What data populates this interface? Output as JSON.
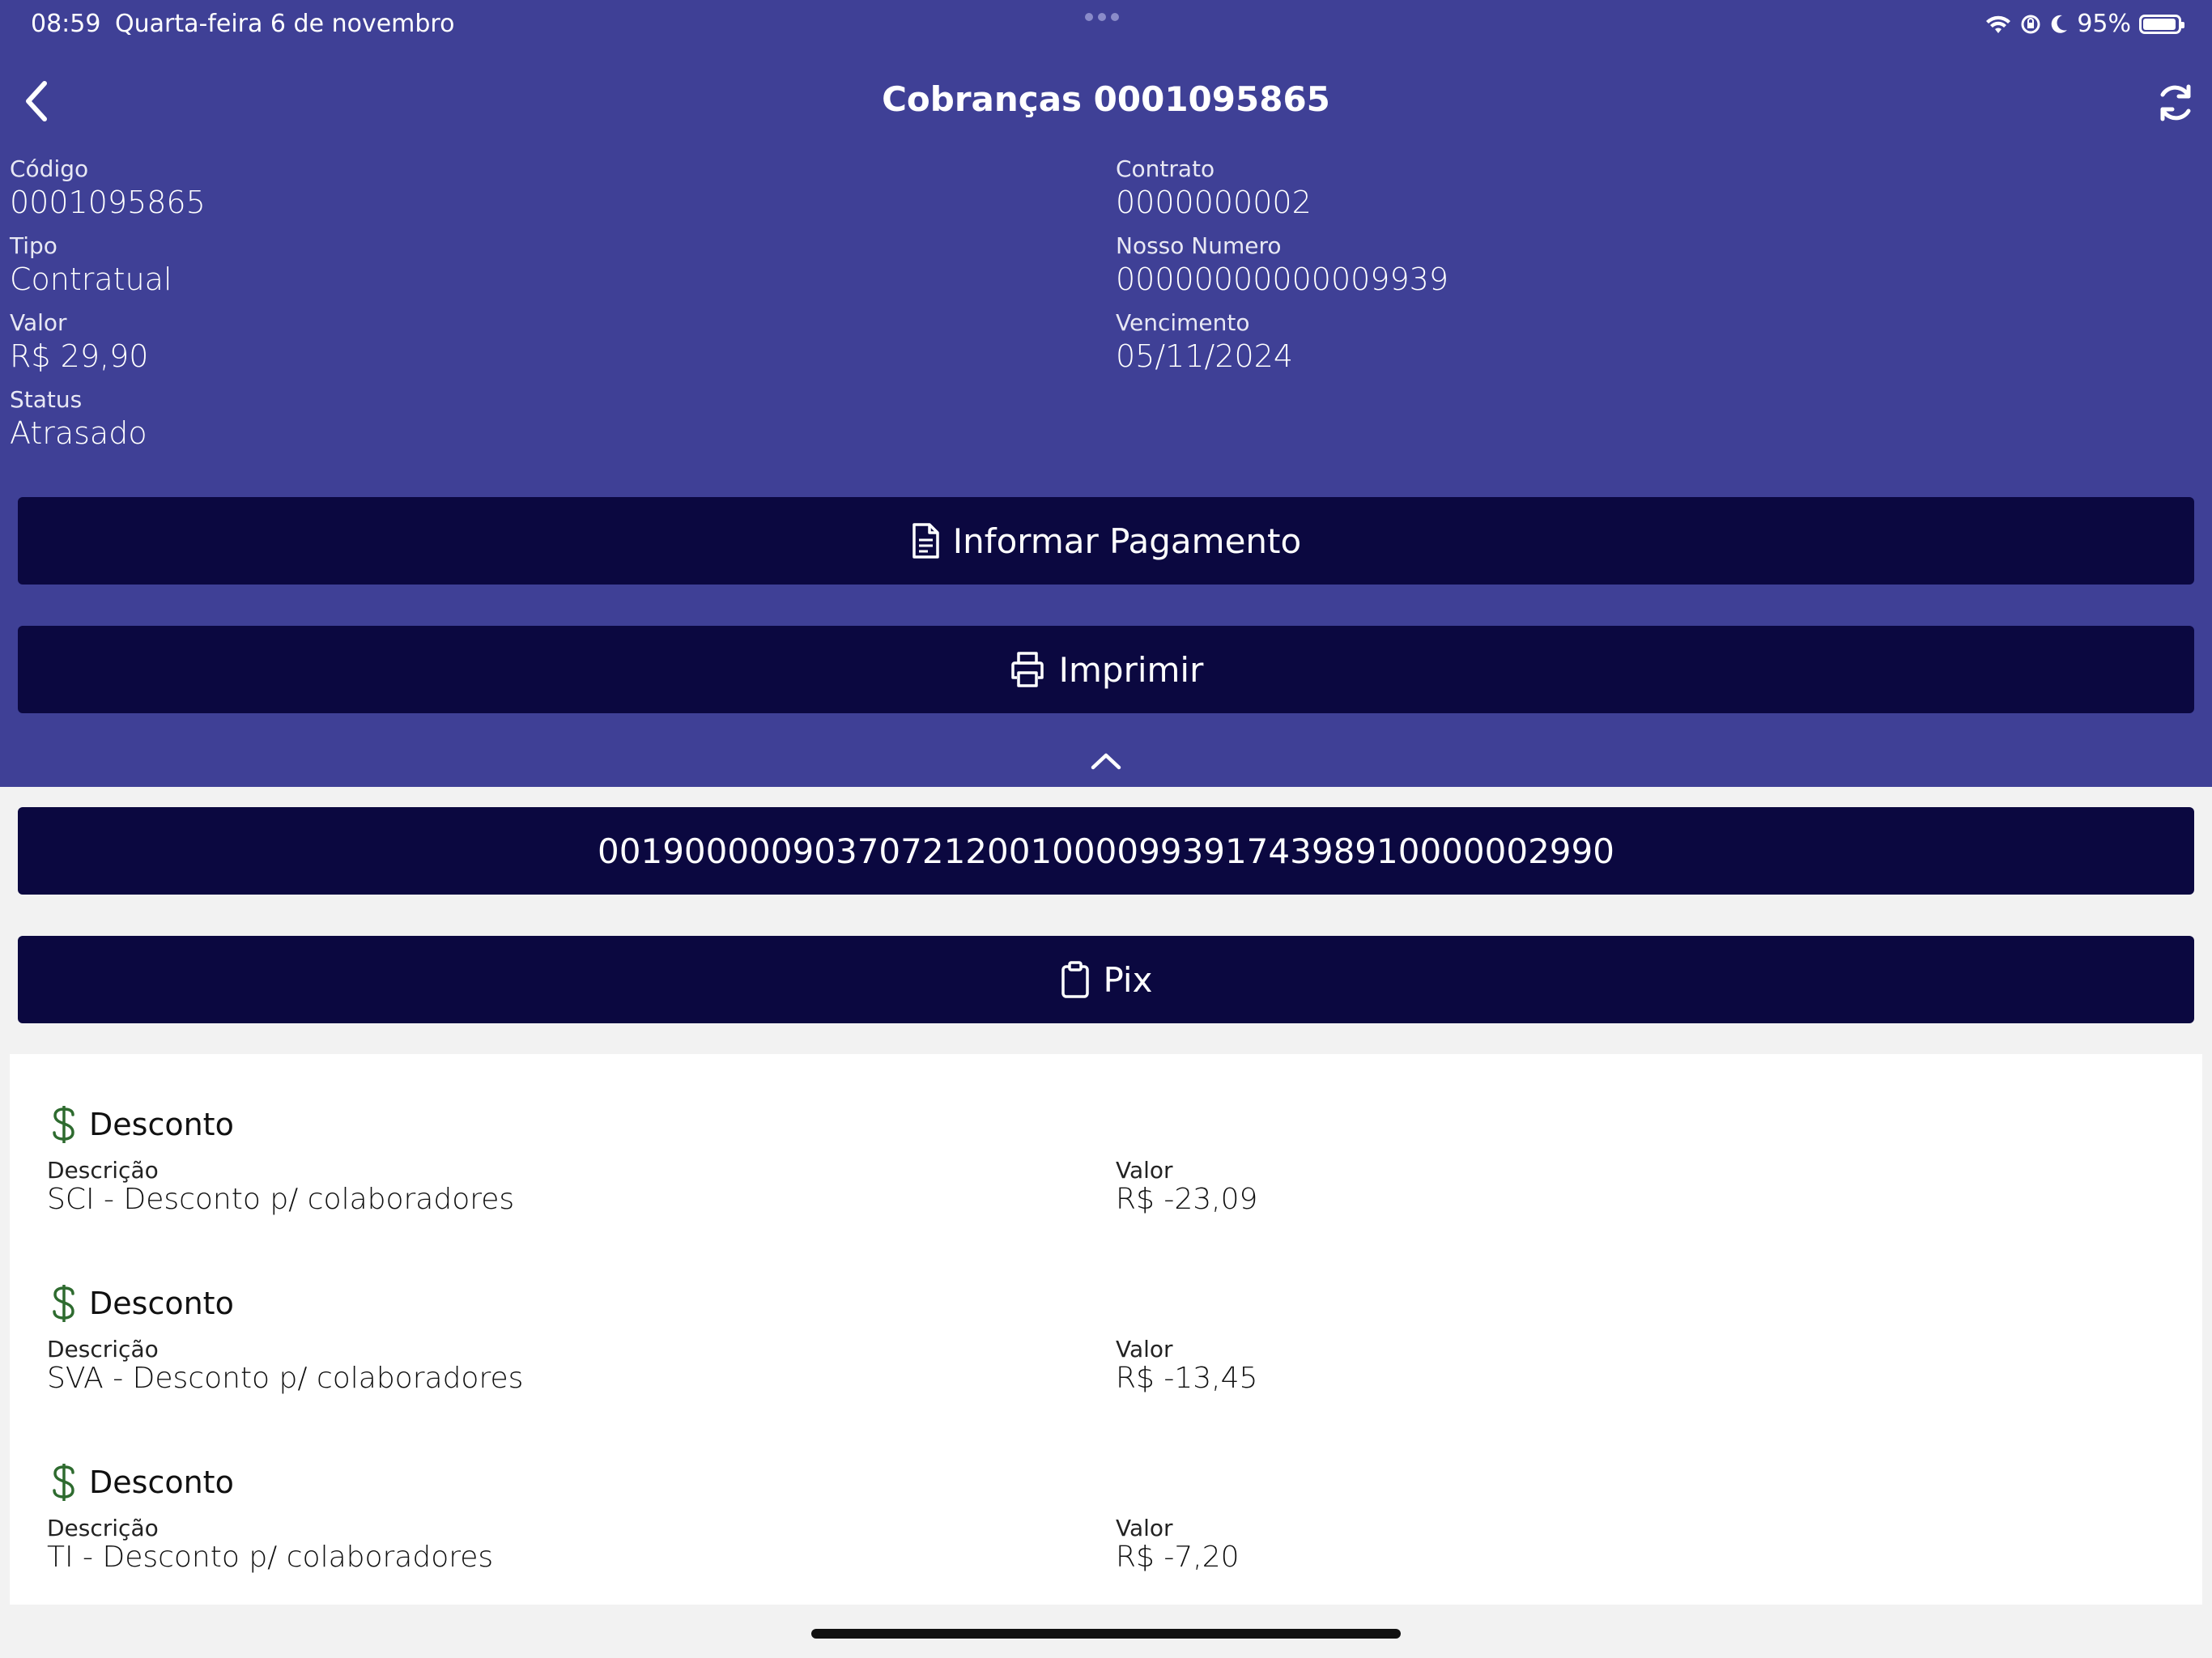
{
  "status_bar": {
    "time": "08:59",
    "date": "Quarta-feira 6 de novembro",
    "battery": "95%",
    "battery_level": 0.95
  },
  "nav": {
    "title": "Cobranças 0001095865"
  },
  "fields": {
    "codigo": {
      "label": "Código",
      "value": "0001095865"
    },
    "contrato": {
      "label": "Contrato",
      "value": "0000000002"
    },
    "tipo": {
      "label": "Tipo",
      "value": "Contratual"
    },
    "nosso_numero": {
      "label": "Nosso Numero",
      "value": "00000000000009939"
    },
    "valor": {
      "label": "Valor",
      "value": "R$ 29,90"
    },
    "vencimento": {
      "label": "Vencimento",
      "value": "05/11/2024"
    },
    "status": {
      "label": "Status",
      "value": "Atrasado"
    }
  },
  "actions": {
    "informar_pagamento": "Informar Pagamento",
    "imprimir": "Imprimir",
    "barcode": "00190000090370721200100009939174398910000002990",
    "pix": "Pix"
  },
  "items": [
    {
      "title": "Desconto",
      "desc_label": "Descrição",
      "desc_value": "SCI - Desconto p/ colaboradores",
      "val_label": "Valor",
      "val_value": "R$ -23,09"
    },
    {
      "title": "Desconto",
      "desc_label": "Descrição",
      "desc_value": "SVA - Desconto p/ colaboradores",
      "val_label": "Valor",
      "val_value": "R$ -13,45"
    },
    {
      "title": "Desconto",
      "desc_label": "Descrição",
      "desc_value": "TI - Desconto p/ colaboradores",
      "val_label": "Valor",
      "val_value": "R$ -7,20"
    }
  ],
  "colors": {
    "header_bg": "#3f4096",
    "button_bg": "#0b0840",
    "page_bg": "#f2f2f2",
    "dollar_icon": "#2e6b2f"
  },
  "icons": {
    "back": "chevron-left-icon",
    "refresh": "refresh-icon",
    "document": "document-icon",
    "printer": "printer-icon",
    "collapse": "chevron-up-icon",
    "clipboard": "clipboard-icon",
    "dollar": "dollar-icon"
  }
}
